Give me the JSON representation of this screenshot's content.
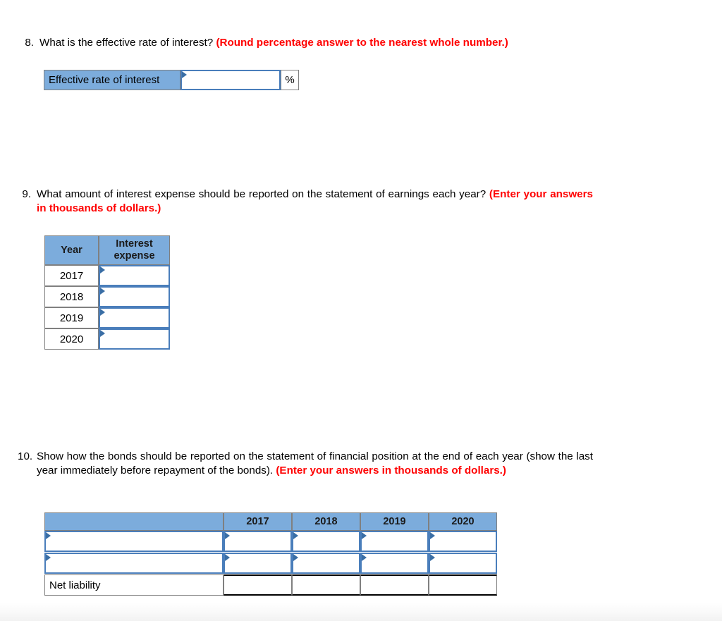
{
  "questions": [
    {
      "number": "8.",
      "text_parts": [
        {
          "text": "What is the effective rate of interest? ",
          "style": "normal"
        },
        {
          "text": "(Round percentage answer to the nearest whole number.)",
          "style": "red"
        }
      ]
    },
    {
      "number": "9.",
      "text_parts": [
        {
          "text": "What amount of interest expense should be reported on the statement of earnings each year? ",
          "style": "normal"
        },
        {
          "text": "(Enter your answers in thousands of dollars.)",
          "style": "red"
        }
      ]
    },
    {
      "number": "10.",
      "text_parts": [
        {
          "text": "Show how the bonds should be reported on the statement of financial position at the end of each year (show the last year immediately before repayment of the bonds).  ",
          "style": "normal"
        },
        {
          "text": "(Enter your answers in thousands of dollars.)",
          "style": "red"
        }
      ]
    }
  ],
  "q8_table": {
    "label": "Effective rate of interest",
    "input_value": "",
    "unit_suffix": "%"
  },
  "q9_table": {
    "headers": [
      "Year",
      "Interest expense"
    ],
    "rows": [
      {
        "year": "2017",
        "interest_expense": ""
      },
      {
        "year": "2018",
        "interest_expense": ""
      },
      {
        "year": "2019",
        "interest_expense": ""
      },
      {
        "year": "2020",
        "interest_expense": ""
      }
    ]
  },
  "q10_table": {
    "headers": [
      "",
      "2017",
      "2018",
      "2019",
      "2020"
    ],
    "rows": [
      {
        "label": "",
        "editable_label": true,
        "values": [
          "",
          "",
          "",
          ""
        ]
      },
      {
        "label": "",
        "editable_label": true,
        "values": [
          "",
          "",
          "",
          ""
        ]
      },
      {
        "label": "Net liability",
        "editable_label": false,
        "values": [
          "",
          "",
          "",
          ""
        ]
      }
    ]
  },
  "colors": {
    "header_blue": "#7cacdc",
    "input_border_blue": "#4a7ebb",
    "flag_blue": "#3a6ea5",
    "red_text": "#ff0000",
    "cell_border_gray": "#808080",
    "total_border": "#000000"
  }
}
